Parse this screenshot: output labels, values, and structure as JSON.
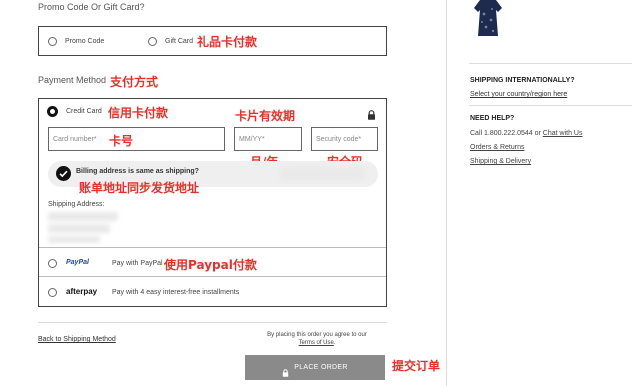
{
  "promo": {
    "title": "Promo Code Or Gift Card?",
    "option_promo": "Promo Code",
    "option_gift": "Gift Card",
    "annotation_gift": "礼品卡付款"
  },
  "payment": {
    "title": "Payment Method",
    "annotation_title": "支付方式",
    "credit": {
      "label": "Credit Card",
      "annotation": "信用卡付款",
      "annotation_expiry": "卡片有效期",
      "card_placeholder": "Card number*",
      "annotation_card": "卡号",
      "expiry_placeholder": "MM/YY*",
      "annotation_expiry_fmt": "月/年",
      "security_placeholder": "Security code*",
      "annotation_security": "安全码",
      "billing_label": "Billing address is same as shipping?",
      "annotation_billing": "账单地址同步发货地址",
      "shipping_address_label": "Shipping Address:"
    },
    "paypal": {
      "logo": "PayPal",
      "label": "Pay with PayPal",
      "annotation": "使用Paypal付款"
    },
    "afterpay": {
      "logo": "afterpay",
      "label": "Pay with 4 easy interest-free installments"
    }
  },
  "footer": {
    "back_link": "Back to Shipping Method",
    "terms_prefix": "By placing this order you agree to our",
    "terms_link": "Terms of Use",
    "terms_suffix": ".",
    "place_order": "PLACE ORDER",
    "annotation_place": "提交订单"
  },
  "sidebar": {
    "shipping_title": "SHIPPING INTERNATIONALLY?",
    "shipping_link": "Select your country/region here",
    "help_title": "NEED HELP?",
    "help_phone": "Call 1.800.222.0544 or",
    "help_chat": "Chat with Us",
    "help_orders": "Orders & Returns",
    "help_shipping": "Shipping & Delivery"
  },
  "colors": {
    "annotation": "#e8302a",
    "place_order_bg": "#8a8a8a",
    "divider": "#dcdcdc"
  }
}
